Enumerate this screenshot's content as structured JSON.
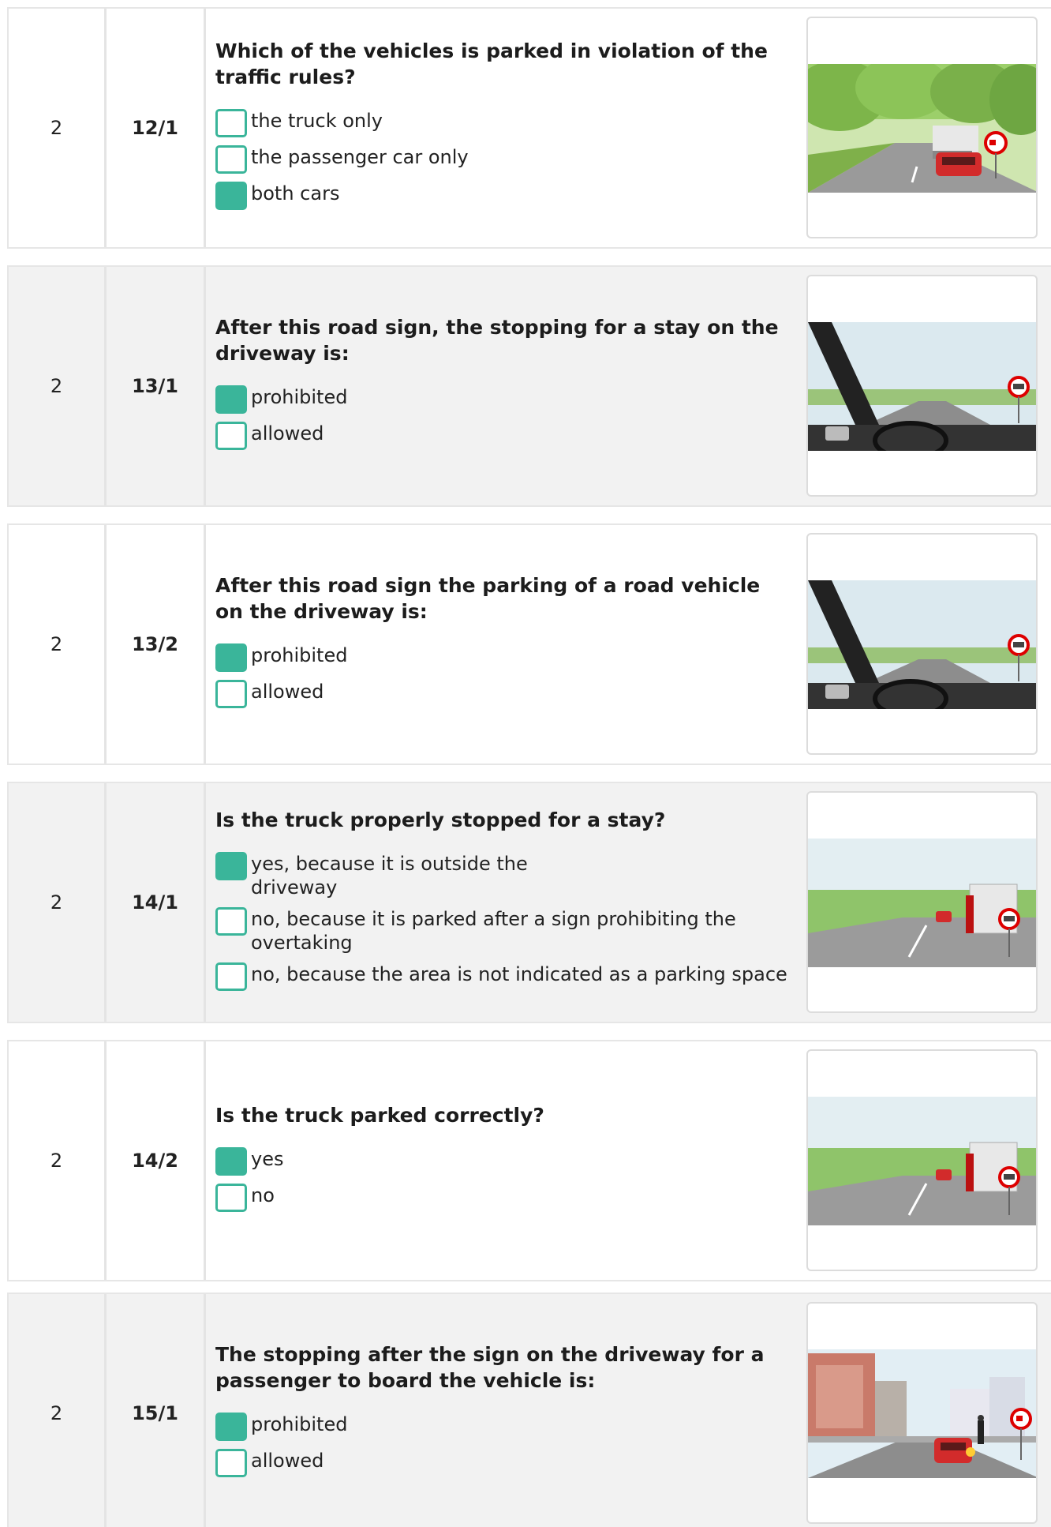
{
  "rows": [
    {
      "points": "2",
      "number": "12/1",
      "question": "Which of the vehicles is parked in violation of the traffic rules?",
      "answers": [
        {
          "text": "the truck only",
          "checked": false
        },
        {
          "text": "the passenger car only",
          "checked": false
        },
        {
          "text": "both cars",
          "checked": true
        }
      ],
      "image": "tree-lined-road-truck-car-sign"
    },
    {
      "points": "2",
      "number": "13/1",
      "question": "After this road sign, the stopping for a stay on the driveway is:",
      "answers": [
        {
          "text": "prohibited",
          "checked": true
        },
        {
          "text": "allowed",
          "checked": false
        }
      ],
      "image": "driver-view-road-sign"
    },
    {
      "points": "2",
      "number": "13/2",
      "question": "After this road sign the parking of a road vehicle on the driveway is:",
      "answers": [
        {
          "text": "prohibited",
          "checked": true
        },
        {
          "text": "allowed",
          "checked": false
        }
      ],
      "image": "driver-view-road-sign"
    },
    {
      "points": "2",
      "number": "14/1",
      "question": "Is the truck properly stopped for a stay?",
      "answers": [
        {
          "text": "yes, because it is outside the driveway",
          "checked": true
        },
        {
          "text": "no, because it is parked after a sign prohibiting the overtaking",
          "checked": false
        },
        {
          "text": "no, because the area is not indicated as a parking space",
          "checked": false
        }
      ],
      "image": "roadside-truck-sign"
    },
    {
      "points": "2",
      "number": "14/2",
      "question": "Is the truck parked correctly?",
      "answers": [
        {
          "text": "yes",
          "checked": true
        },
        {
          "text": "no",
          "checked": false
        }
      ],
      "image": "roadside-truck-sign"
    },
    {
      "points": "2",
      "number": "15/1",
      "question": "The stopping after the sign on the driveway for a passenger to board the vehicle is:",
      "answers": [
        {
          "text": "prohibited",
          "checked": true
        },
        {
          "text": "allowed",
          "checked": false
        }
      ],
      "image": "city-street-car-passenger-sign"
    }
  ],
  "colors": {
    "accent": "#3ab59a",
    "row_alt": "#f2f2f2",
    "border": "#e6e6e6"
  }
}
